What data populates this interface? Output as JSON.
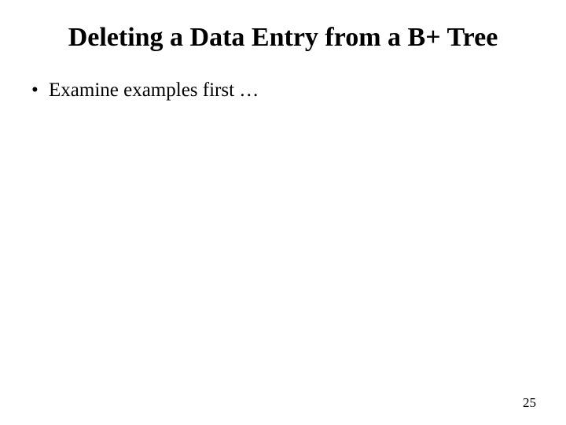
{
  "slide": {
    "title": "Deleting a Data Entry from a B+ Tree",
    "bullets": [
      "Examine examples first …"
    ],
    "page_number": "25"
  }
}
